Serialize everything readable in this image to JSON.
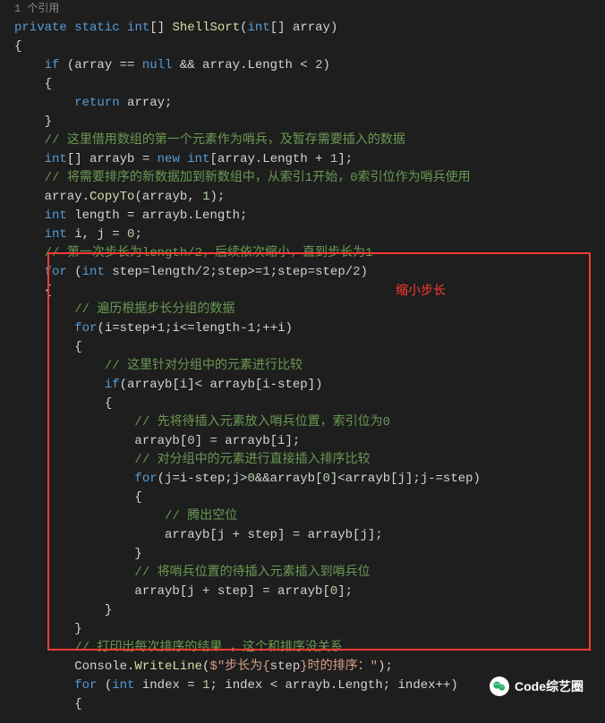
{
  "code": {
    "l1": "1 个引用",
    "l2_a": "private",
    "l2_b": "static",
    "l2_c": "int",
    "l2_d": "[] ",
    "l2_e": "ShellSort",
    "l2_f": "(",
    "l2_g": "int",
    "l2_h": "[] array)",
    "l3": "{",
    "l4_a": "    ",
    "l4_b": "if",
    "l4_c": " (array == ",
    "l4_d": "null",
    "l4_e": " && array.Length < ",
    "l4_f": "2",
    "l4_g": ")",
    "l5": "    {",
    "l6_a": "        ",
    "l6_b": "return",
    "l6_c": " array;",
    "l7": "    }",
    "l8_a": "    ",
    "l8_b": "// 这里借用数组的第一个元素作为哨兵，及暂存需要插入的数据",
    "l9_a": "    ",
    "l9_b": "int",
    "l9_c": "[] arrayb = ",
    "l9_d": "new",
    "l9_e": " ",
    "l9_f": "int",
    "l9_g": "[array.Length + ",
    "l9_h": "1",
    "l9_i": "];",
    "l10_a": "    ",
    "l10_b": "// 将需要排序的新数据加到新数组中，从索引1开始，0索引位作为哨兵使用",
    "l11_a": "    array.",
    "l11_b": "CopyTo",
    "l11_c": "(arrayb, ",
    "l11_d": "1",
    "l11_e": ");",
    "l12": "",
    "l13_a": "    ",
    "l13_b": "int",
    "l13_c": " length = arrayb.Length;",
    "l14_a": "    ",
    "l14_b": "int",
    "l14_c": " i, j = ",
    "l14_d": "0",
    "l14_e": ";",
    "l15_a": "    ",
    "l15_b": "// 第一次步长为length/2，后续依次缩小，直到步长为1",
    "l16_a": "    ",
    "l16_b": "for",
    "l16_c": " (",
    "l16_d": "int",
    "l16_e": " step=length/",
    "l16_f": "2",
    "l16_g": ";step>=",
    "l16_h": "1",
    "l16_i": ";step=step/",
    "l16_j": "2",
    "l16_k": ")",
    "l17": "    {",
    "l18_a": "        ",
    "l18_b": "// 遍历根据步长分组的数据",
    "l19_a": "        ",
    "l19_b": "for",
    "l19_c": "(i=step+",
    "l19_d": "1",
    "l19_e": ";i<=length-",
    "l19_f": "1",
    "l19_g": ";++i)",
    "l20": "        {",
    "l21_a": "            ",
    "l21_b": "// 这里针对分组中的元素进行比较",
    "l22_a": "            ",
    "l22_b": "if",
    "l22_c": "(arrayb[i]< arrayb[i-step])",
    "l23": "            {",
    "l24_a": "                ",
    "l24_b": "// 先将待插入元素放入哨兵位置，索引位为0",
    "l25_a": "                arrayb[",
    "l25_b": "0",
    "l25_c": "] = arrayb[i];",
    "l26_a": "                ",
    "l26_b": "// 对分组中的元素进行直接插入排序比较",
    "l27_a": "                ",
    "l27_b": "for",
    "l27_c": "(j=i-step;j>",
    "l27_d": "0",
    "l27_e": "&&arrayb[",
    "l27_f": "0",
    "l27_g": "]<arrayb[j];j-=step)",
    "l28": "                {",
    "l29_a": "                    ",
    "l29_b": "// 腾出空位",
    "l30": "                    arrayb[j + step] = arrayb[j];",
    "l31": "                }",
    "l32_a": "                ",
    "l32_b": "// 将哨兵位置的待插入元素插入到哨兵位",
    "l33_a": "                arrayb[j + step] = arrayb[",
    "l33_b": "0",
    "l33_c": "];",
    "l34": "            }",
    "l35": "        }",
    "l36_a": "        ",
    "l36_b": "// 打印出每次排序的结果 ，这个和排序没关系",
    "l37_a": "        Console.",
    "l37_b": "WriteLine",
    "l37_c": "(",
    "l37_d": "$\"步长为{",
    "l37_e": "step",
    "l37_f": "}时的排序：\"",
    "l37_g": ");",
    "l38_a": "        ",
    "l38_b": "for",
    "l38_c": " (",
    "l38_d": "int",
    "l38_e": " index = ",
    "l38_f": "1",
    "l38_g": "; index < arrayb.Length; index++)",
    "l39": "        {"
  },
  "annot": {
    "shrink": "缩小步长"
  },
  "watermark": {
    "text": "Code综艺圈"
  }
}
